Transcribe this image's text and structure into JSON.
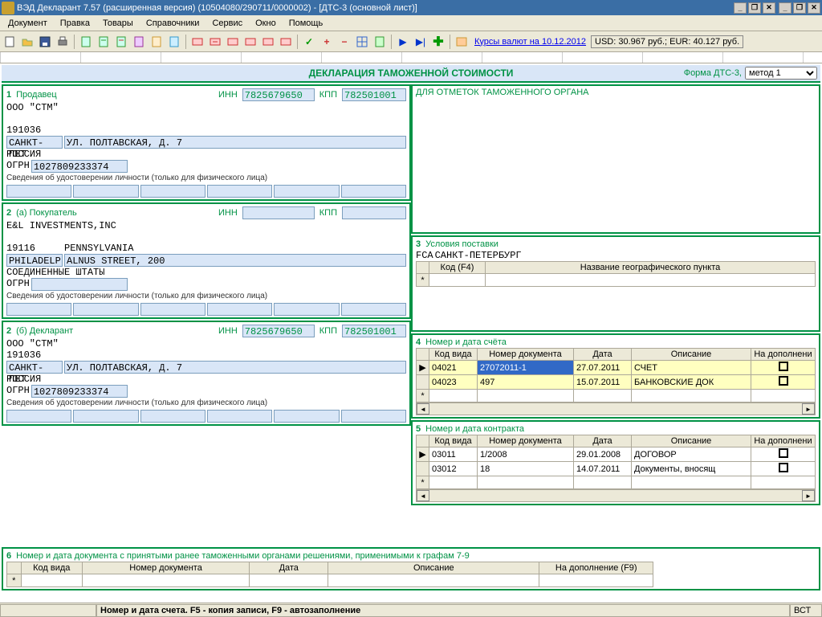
{
  "titlebar": {
    "title": "ВЭД Декларант 7.57 (расширенная версия) (10504080/290711/0000002) - [ДТС-3 (основной лист)]"
  },
  "menu": [
    "Документ",
    "Правка",
    "Товары",
    "Справочники",
    "Сервис",
    "Окно",
    "Помощь"
  ],
  "toolbar": {
    "rates_link": "Курсы валют на 10.12.2012",
    "rates": "USD: 30.967 руб.; EUR: 40.127 руб."
  },
  "form": {
    "title": "ДЕКЛАРАЦИЯ ТАМОЖЕННОЙ СТОИМОСТИ",
    "formtype": "Форма ДТС-3,",
    "method": "метод 1"
  },
  "seller": {
    "num": "1",
    "label": "Продавец",
    "inn_lbl": "ИНН",
    "inn": "7825679650",
    "kpp_lbl": "КПП",
    "kpp": "782501001",
    "name": "ООО \"СТМ\"",
    "zip": "191036",
    "city": "САНКТ-ПЕТ",
    "addr": "УЛ. ПОЛТАВСКАЯ, Д. 7",
    "country": "РОССИЯ",
    "ogrn_lbl": "ОГРН",
    "ogrn": "1027809233374",
    "idinfo": "Сведения об удостоверении личности (только для физического лица)"
  },
  "buyer": {
    "num": "2",
    "label": "(а)  Покупатель",
    "inn_lbl": "ИНН",
    "kpp_lbl": "КПП",
    "name": "E&L INVESTMENTS,INC",
    "zip": "19116",
    "region": "PENNSYLVANIA",
    "city": "PHILADELP",
    "addr": "ALNUS STREET, 200",
    "country": "СОЕДИНЕННЫЕ ШТАТЫ",
    "ogrn_lbl": "ОГРН",
    "idinfo": "Сведения об удостоверении личности (только для физического лица)"
  },
  "declarant": {
    "num": "2",
    "label": "(б)  Декларант",
    "inn_lbl": "ИНН",
    "inn": "7825679650",
    "kpp_lbl": "КПП",
    "kpp": "782501001",
    "name": "ООО \"СТМ\"",
    "zip": "191036",
    "city": "САНКТ-ПЕТ",
    "addr": "УЛ. ПОЛТАВСКАЯ, Д. 7",
    "country": "РОССИЯ",
    "ogrn_lbl": "ОГРН",
    "ogrn": "1027809233374",
    "idinfo": "Сведения об удостоверении личности (только для физического лица)"
  },
  "customs_marks": {
    "label": "ДЛЯ ОТМЕТОК ТАМОЖЕННОГО ОРГАНА"
  },
  "delivery": {
    "num": "3",
    "label": "Условия поставки",
    "terms": "FCA",
    "place": "САНКТ-ПЕТЕРБУРГ",
    "col1": "Код (F4)",
    "col2": "Название географического пункта"
  },
  "invoice": {
    "num": "4",
    "label": "Номер и дата счёта",
    "cols": [
      "Код вида",
      "Номер документа",
      "Дата",
      "Описание",
      "На дополнени"
    ],
    "rows": [
      {
        "code": "04021",
        "doc": "27072011-1",
        "date": "27.07.2011",
        "desc": "СЧЕТ"
      },
      {
        "code": "04023",
        "doc": "497",
        "date": "15.07.2011",
        "desc": "БАНКОВСКИЕ ДОК"
      }
    ]
  },
  "contract": {
    "num": "5",
    "label": "Номер и дата контракта",
    "cols": [
      "Код вида",
      "Номер документа",
      "Дата",
      "Описание",
      "На дополнени"
    ],
    "rows": [
      {
        "code": "03011",
        "doc": "1/2008",
        "date": "29.01.2008",
        "desc": "ДОГОВОР"
      },
      {
        "code": "03012",
        "doc": "18",
        "date": "14.07.2011",
        "desc": "Документы, вносящ"
      }
    ]
  },
  "earlier_docs": {
    "num": "6",
    "label": "Номер и дата документа с принятыми ранее таможенными органами решениями, применимыми к графам 7-9",
    "cols": [
      "Код вида",
      "Номер документа",
      "Дата",
      "Описание",
      "На дополнение (F9)"
    ]
  },
  "statusbar": {
    "msg": "Номер и дата счета. F5 - копия записи, F9 - автозаполнение",
    "mode": "ВСТ"
  }
}
